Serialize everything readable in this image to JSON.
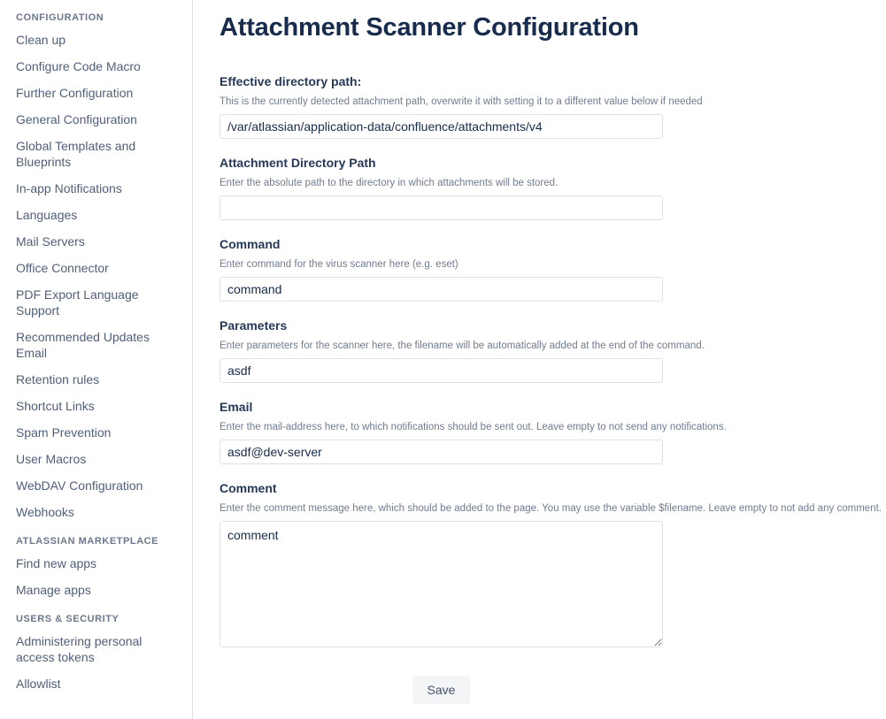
{
  "page": {
    "title": "Attachment Scanner Configuration"
  },
  "colors": {
    "heading": "#172b4d",
    "label": "#253858",
    "description": "#707c91",
    "link": "#505f79",
    "section_heading": "#6b778c",
    "input_border": "#dfe1e6",
    "button_background": "#f4f5f7",
    "button_text": "#42526e",
    "divider": "#dfe1e6",
    "background": "#ffffff"
  },
  "sidebar": {
    "sections": [
      {
        "heading": "CONFIGURATION",
        "items": [
          {
            "label": "Clean up"
          },
          {
            "label": "Configure Code Macro"
          },
          {
            "label": "Further Configuration"
          },
          {
            "label": "General Configuration"
          },
          {
            "label": "Global Templates and Blueprints"
          },
          {
            "label": "In-app Notifications"
          },
          {
            "label": "Languages"
          },
          {
            "label": "Mail Servers"
          },
          {
            "label": "Office Connector"
          },
          {
            "label": "PDF Export Language Support"
          },
          {
            "label": "Recommended Updates Email"
          },
          {
            "label": "Retention rules"
          },
          {
            "label": "Shortcut Links"
          },
          {
            "label": "Spam Prevention"
          },
          {
            "label": "User Macros"
          },
          {
            "label": "WebDAV Configuration"
          },
          {
            "label": "Webhooks"
          }
        ]
      },
      {
        "heading": "ATLASSIAN MARKETPLACE",
        "items": [
          {
            "label": "Find new apps"
          },
          {
            "label": "Manage apps"
          }
        ]
      },
      {
        "heading": "USERS & SECURITY",
        "items": [
          {
            "label": "Administering personal access tokens"
          },
          {
            "label": "Allowlist"
          }
        ]
      }
    ]
  },
  "form": {
    "fields": [
      {
        "label": "Effective directory path:",
        "description": "This is the currently detected attachment path, overwrite it with setting it to a different value below if needed",
        "value": "/var/atlassian/application-data/confluence/attachments/v4",
        "placeholder": "",
        "type": "text"
      },
      {
        "label": "Attachment Directory Path",
        "description": "Enter the absolute path to the directory in which attachments will be stored.",
        "value": "",
        "placeholder": "",
        "type": "text"
      },
      {
        "label": "Command",
        "description": "Enter command for the virus scanner here (e.g. eset)",
        "value": "command",
        "placeholder": "",
        "type": "text"
      },
      {
        "label": "Parameters",
        "description": "Enter parameters for the scanner here, the filename will be automatically added at the end of the command.",
        "value": "asdf",
        "placeholder": "",
        "type": "text"
      },
      {
        "label": "Email",
        "description": "Enter the mail-address here, to which notifications should be sent out. Leave empty to not send any notifications.",
        "value": "asdf@dev-server",
        "placeholder": "",
        "type": "text"
      },
      {
        "label": "Comment",
        "description": "Enter the comment message here, which should be added to the page. You may use the variable $filename. Leave empty to not add any comment.",
        "value": "comment",
        "placeholder": "",
        "type": "textarea"
      }
    ],
    "save_label": "Save"
  }
}
